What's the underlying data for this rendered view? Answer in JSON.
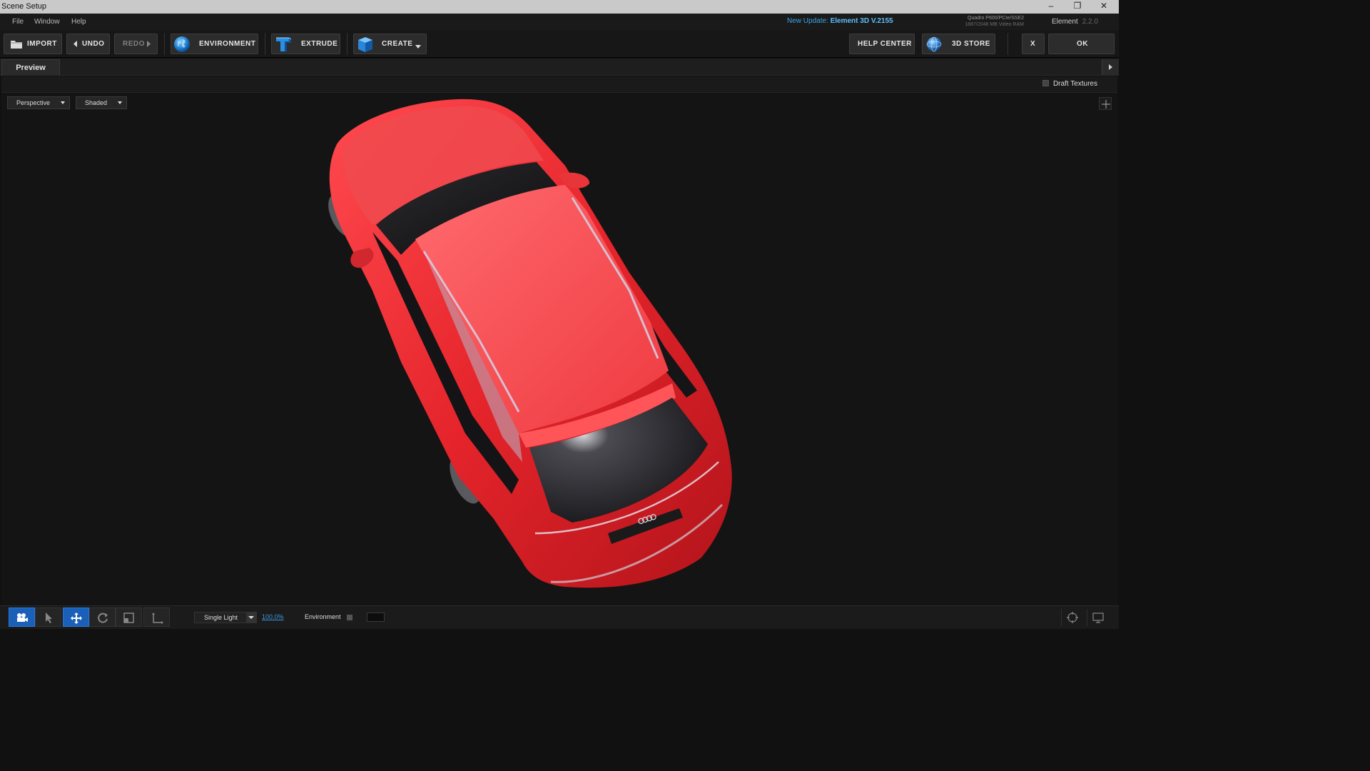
{
  "window": {
    "title": "Scene Setup",
    "minimize": "–",
    "restore": "❐",
    "close": "✕"
  },
  "menu": {
    "items": [
      "File",
      "Window",
      "Help"
    ]
  },
  "update": {
    "prefix": "New Update:",
    "version": "Element 3D V.2155"
  },
  "gpu": {
    "line1": "Quadro P600/PCIe/SSE2",
    "line2": "1887/2048 MB Video RAM"
  },
  "app": {
    "name": "Element",
    "version": "2.2.0"
  },
  "toolbar": {
    "import": "IMPORT",
    "undo": "UNDO",
    "redo": "REDO",
    "environment": "ENVIRONMENT",
    "extrude": "EXTRUDE",
    "create": "CREATE",
    "help_center": "HELP CENTER",
    "store": "3D STORE",
    "close": "X",
    "ok": "OK"
  },
  "tabs": {
    "preview": "Preview"
  },
  "viewport": {
    "draft_textures": "Draft Textures",
    "view_mode": "Perspective",
    "shading": "Shaded"
  },
  "bottom": {
    "light_mode": "Single Light",
    "light_intensity": "100.0%",
    "environment_label": "Environment"
  },
  "colors": {
    "accent": "#1b60b8",
    "link": "#3a9ae0",
    "car_body": "#e8262c"
  },
  "icons": [
    "folder-icon",
    "globe-icon",
    "extrude-icon",
    "cube-icon",
    "camera-icon",
    "pointer-icon",
    "move-icon",
    "rotate-icon",
    "scale-icon",
    "axis-icon",
    "target-icon",
    "monitor-icon"
  ]
}
